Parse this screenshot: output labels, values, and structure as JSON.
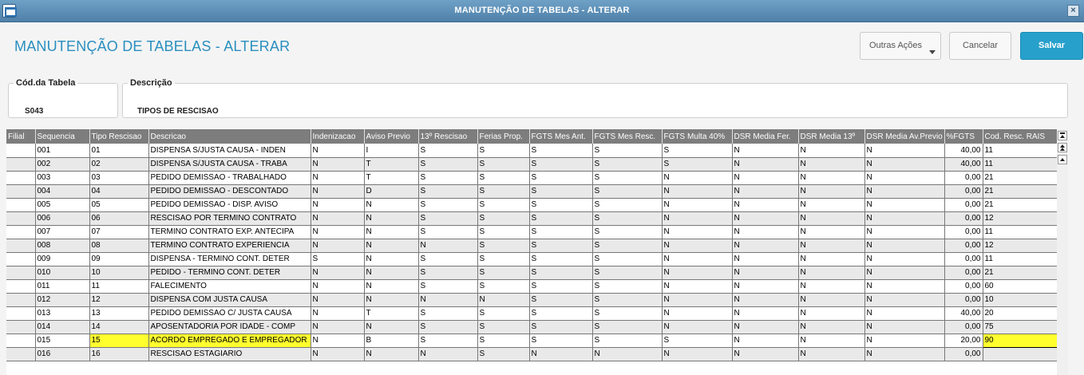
{
  "window": {
    "title": "MANUTENÇÃO DE TABELAS - ALTERAR",
    "close_label": "×"
  },
  "header": {
    "title": "MANUTENÇÃO DE TABELAS - ALTERAR"
  },
  "actions": {
    "outras_label": "Outras Ações",
    "cancelar_label": "Cancelar",
    "salvar_label": "Salvar"
  },
  "form": {
    "cod_tabela": {
      "label": "Cód.da Tabela",
      "value": "S043"
    },
    "descricao": {
      "label": "Descrição",
      "value": "TIPOS DE RESCISAO"
    }
  },
  "grid": {
    "columns": [
      "Filial",
      "Sequencia",
      "Tipo Rescisao",
      "Descricao",
      "Indenizacao",
      "Aviso Previo",
      "13º Rescisao",
      "Ferias Prop.",
      "FGTS Mes Ant.",
      "FGTS Mes Resc.",
      "FGTS Multa 40%",
      "DSR Media Fer.",
      "DSR Media 13º",
      "DSR Media Av.Previo",
      "%FGTS",
      "Cod. Resc. RAIS"
    ],
    "rows": [
      [
        "",
        "001",
        "01",
        "DISPENSA S/JUSTA CAUSA - INDEN",
        "N",
        "I",
        "S",
        "S",
        "S",
        "S",
        "S",
        "N",
        "N",
        "N",
        "40,00",
        "11"
      ],
      [
        "",
        "002",
        "02",
        "DISPENSA S/JUSTA CAUSA - TRABA",
        "N",
        "T",
        "S",
        "S",
        "S",
        "S",
        "S",
        "N",
        "N",
        "N",
        "40,00",
        "11"
      ],
      [
        "",
        "003",
        "03",
        "PEDIDO DEMISSAO - TRABALHADO",
        "N",
        "T",
        "S",
        "S",
        "S",
        "S",
        "N",
        "N",
        "N",
        "N",
        "0,00",
        "21"
      ],
      [
        "",
        "004",
        "04",
        "PEDIDO DEMISSAO - DESCONTADO",
        "N",
        "D",
        "S",
        "S",
        "S",
        "S",
        "N",
        "N",
        "N",
        "N",
        "0,00",
        "21"
      ],
      [
        "",
        "005",
        "05",
        "PEDIDO DEMISSAO - DISP. AVISO",
        "N",
        "N",
        "S",
        "S",
        "S",
        "S",
        "N",
        "N",
        "N",
        "N",
        "0,00",
        "21"
      ],
      [
        "",
        "006",
        "06",
        "RESCISAO POR TERMINO CONTRATO",
        "N",
        "N",
        "S",
        "S",
        "S",
        "S",
        "N",
        "N",
        "N",
        "N",
        "0,00",
        "12"
      ],
      [
        "",
        "007",
        "07",
        "TERMINO CONTRATO EXP. ANTECIPA",
        "N",
        "N",
        "S",
        "S",
        "S",
        "S",
        "N",
        "N",
        "N",
        "N",
        "0,00",
        "11"
      ],
      [
        "",
        "008",
        "08",
        "TERMINO CONTRATO EXPERIENCIA",
        "N",
        "N",
        "N",
        "S",
        "S",
        "S",
        "N",
        "N",
        "N",
        "N",
        "0,00",
        "12"
      ],
      [
        "",
        "009",
        "09",
        "DISPENSA - TERMINO CONT. DETER",
        "S",
        "N",
        "S",
        "S",
        "S",
        "S",
        "N",
        "N",
        "N",
        "N",
        "0,00",
        "11"
      ],
      [
        "",
        "010",
        "10",
        "PEDIDO - TERMINO CONT. DETER",
        "N",
        "N",
        "S",
        "S",
        "S",
        "S",
        "N",
        "N",
        "N",
        "N",
        "0,00",
        "21"
      ],
      [
        "",
        "011",
        "11",
        "FALECIMENTO",
        "N",
        "N",
        "S",
        "S",
        "S",
        "S",
        "N",
        "N",
        "N",
        "N",
        "0,00",
        "60"
      ],
      [
        "",
        "012",
        "12",
        "DISPENSA COM JUSTA CAUSA",
        "N",
        "N",
        "N",
        "N",
        "S",
        "S",
        "N",
        "N",
        "N",
        "N",
        "0,00",
        "10"
      ],
      [
        "",
        "013",
        "13",
        "PEDIDO DEMISSAO C/ JUSTA CAUSA",
        "N",
        "T",
        "S",
        "S",
        "S",
        "S",
        "N",
        "N",
        "N",
        "N",
        "40,00",
        "20"
      ],
      [
        "",
        "014",
        "14",
        "APOSENTADORIA POR IDADE - COMP",
        "N",
        "N",
        "S",
        "S",
        "S",
        "S",
        "N",
        "N",
        "N",
        "N",
        "0,00",
        "75"
      ],
      [
        "",
        "015",
        "15",
        "ACORDO EMPREGADO E EMPREGADOR",
        "N",
        "B",
        "S",
        "S",
        "S",
        "S",
        "S",
        "N",
        "N",
        "N",
        "20,00",
        "90"
      ],
      [
        "",
        "016",
        "16",
        "RESCISAO ESTAGIARIO",
        "N",
        "N",
        "N",
        "S",
        "N",
        "N",
        "N",
        "N",
        "N",
        "N",
        "0,00",
        ""
      ]
    ],
    "highlight_color": "#ffff2e"
  },
  "icons": {
    "window_icon": "window-icon",
    "dropdown": "chevron-down-icon",
    "scroll_top": "scroll-top-icon",
    "scroll_up": "scroll-up-icon"
  }
}
